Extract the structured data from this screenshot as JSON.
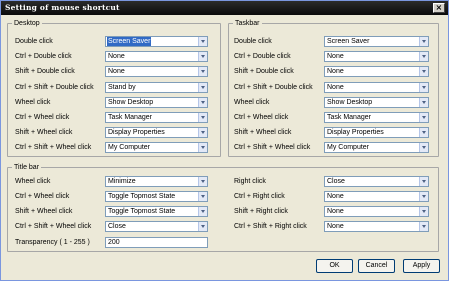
{
  "window": {
    "title": "Setting of mouse shortcut",
    "close_glyph": "×"
  },
  "desktop": {
    "label": "Desktop",
    "rows": [
      {
        "label": "Double click",
        "value": "Screen Saver"
      },
      {
        "label": "Ctrl + Double click",
        "value": "None"
      },
      {
        "label": "Shift + Double click",
        "value": "None"
      },
      {
        "label": "Ctrl + Shift + Double click",
        "value": "Stand by"
      },
      {
        "label": "Wheel click",
        "value": "Show Desktop"
      },
      {
        "label": "Ctrl + Wheel click",
        "value": "Task Manager"
      },
      {
        "label": "Shift + Wheel click",
        "value": "Display Properties"
      },
      {
        "label": "Ctrl + Shift + Wheel click",
        "value": "My Computer"
      }
    ]
  },
  "taskbar": {
    "label": "Taskbar",
    "rows": [
      {
        "label": "Double click",
        "value": "Screen Saver"
      },
      {
        "label": "Ctrl + Double click",
        "value": "None"
      },
      {
        "label": "Shift + Double click",
        "value": "None"
      },
      {
        "label": "Ctrl + Shift + Double click",
        "value": "None"
      },
      {
        "label": "Wheel click",
        "value": "Show Desktop"
      },
      {
        "label": "Ctrl + Wheel click",
        "value": "Task Manager"
      },
      {
        "label": "Shift + Wheel click",
        "value": "Display Properties"
      },
      {
        "label": "Ctrl + Shift + Wheel click",
        "value": "My Computer"
      }
    ]
  },
  "titlebar_group": {
    "label": "Title bar",
    "left_rows": [
      {
        "label": "Wheel click",
        "value": "Minimize"
      },
      {
        "label": "Ctrl + Wheel click",
        "value": "Toggle Topmost State"
      },
      {
        "label": "Shift + Wheel click",
        "value": "Toggle Topmost State"
      },
      {
        "label": "Ctrl + Shift + Wheel click",
        "value": "Close"
      }
    ],
    "right_rows": [
      {
        "label": "Right click",
        "value": "Close"
      },
      {
        "label": "Ctrl + Right click",
        "value": "None"
      },
      {
        "label": "Shift + Right click",
        "value": "None"
      },
      {
        "label": "Ctrl + Shift + Right click",
        "value": "None"
      }
    ],
    "transparency_label": "Transparency ( 1 - 255 )",
    "transparency_value": "200"
  },
  "buttons": {
    "ok": "OK",
    "cancel": "Cancel",
    "apply": "Apply"
  }
}
